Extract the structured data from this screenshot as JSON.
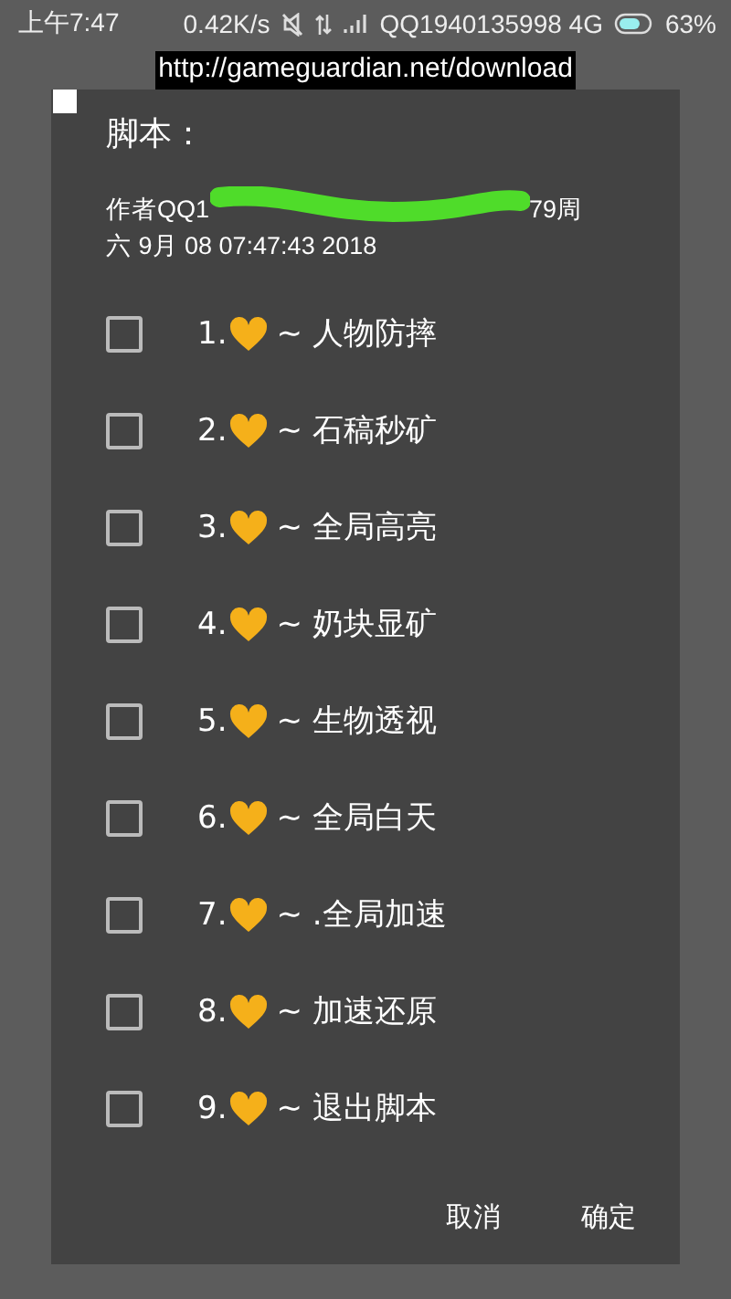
{
  "status_bar": {
    "time": "上午7:47",
    "speed": "0.42K/s",
    "carrier": "QQ1940135998 4G",
    "battery": "63%"
  },
  "url_banner": {
    "text": "http://gameguardian.net/download",
    "checked": false
  },
  "dialog": {
    "title": "脚本：",
    "author_start": "作者QQ1",
    "author_end": "79周",
    "date_line": "六 9月 08 07:47:43 2018",
    "options": [
      {
        "number": "1.",
        "label": "~ 人物防摔",
        "checked": false
      },
      {
        "number": "2.",
        "label": "~ 石稿秒矿",
        "checked": false
      },
      {
        "number": "3.",
        "label": "~ 全局高亮",
        "checked": false
      },
      {
        "number": "4.",
        "label": "~ 奶块显矿",
        "checked": false
      },
      {
        "number": "5.",
        "label": "~ 生物透视",
        "checked": false
      },
      {
        "number": "6.",
        "label": "~ 全局白天",
        "checked": false
      },
      {
        "number": "7.",
        "label": "~ .全局加速",
        "checked": false
      },
      {
        "number": "8.",
        "label": "~ 加速还原",
        "checked": false
      },
      {
        "number": "9.",
        "label": "~ 退出脚本",
        "checked": false
      }
    ],
    "buttons": [
      "取消",
      "确定"
    ]
  }
}
